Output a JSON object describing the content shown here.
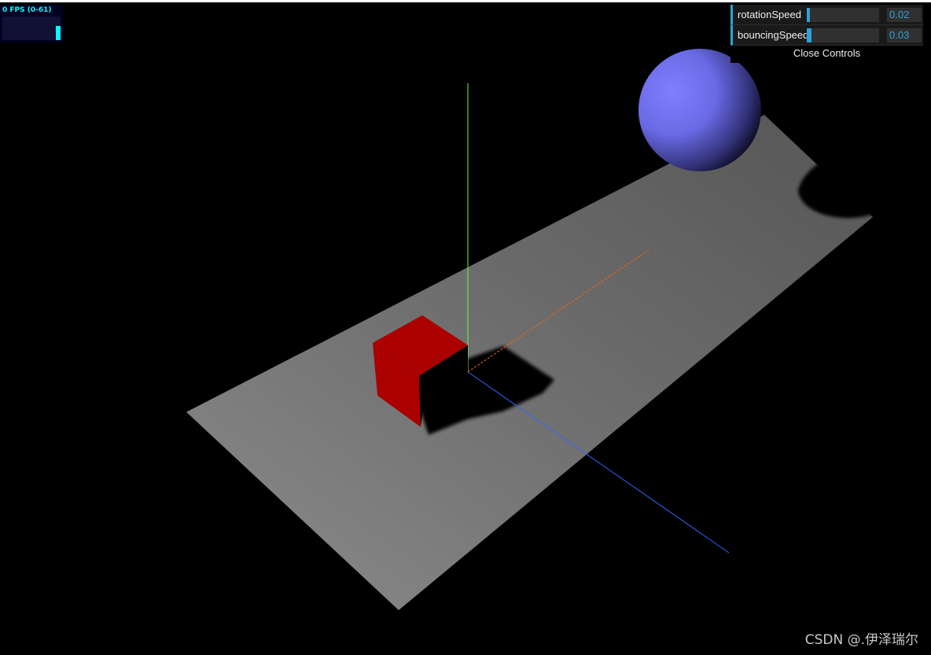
{
  "stats": {
    "fps_label": "0 FPS (0-61)",
    "bars": [
      0.0,
      0.0,
      0.0,
      0.0,
      0.0,
      0.0,
      0.0,
      0.0,
      0.0,
      0.6
    ],
    "color": "#00ffff"
  },
  "gui": {
    "controls": [
      {
        "label": "rotationSpeed",
        "value": "0.02",
        "fraction": 0.04
      },
      {
        "label": "bouncingSpeed",
        "value": "0.03",
        "fraction": 0.06
      }
    ],
    "close_label": "Close Controls",
    "accent": "#2fa1d6"
  },
  "scene": {
    "plane_color": "#808080",
    "cube_color": "#aa0000",
    "sphere_color": "#7777ff",
    "axes_colors": {
      "x": "#ff6600",
      "y": "#66ff33",
      "z": "#3366ff"
    }
  },
  "watermark": "CSDN @.伊泽瑞尔"
}
